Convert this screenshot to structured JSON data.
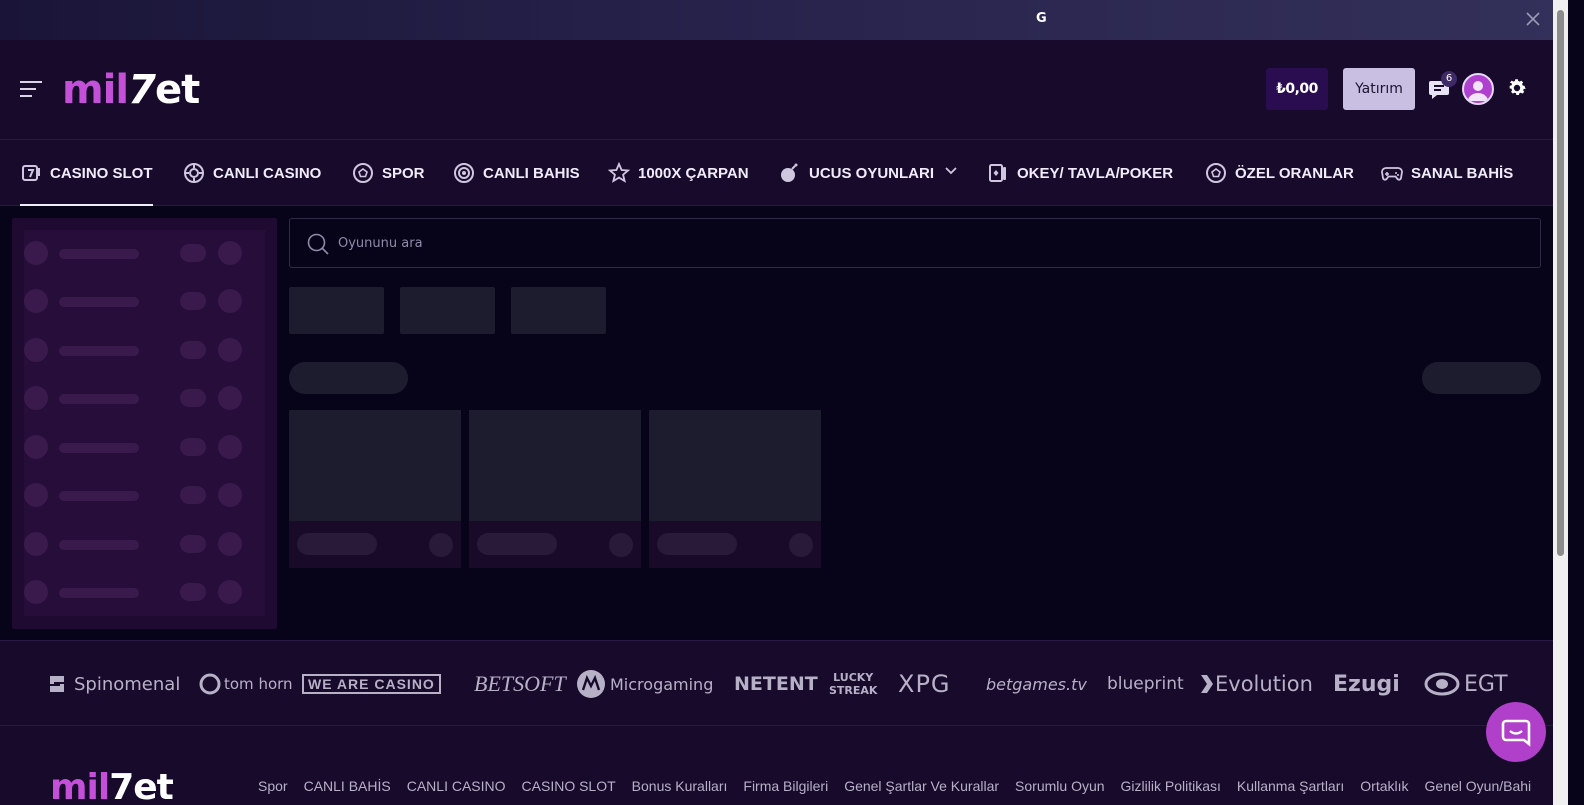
{
  "banner": {
    "text": "G",
    "close_label": "×"
  },
  "header": {
    "logo_parts": {
      "mil": "mil",
      "seven": "7",
      "et": "et"
    },
    "balance": "₺0,00",
    "deposit_label": "Yatırım",
    "messages_badge": "6"
  },
  "nav": {
    "items": [
      {
        "label": "CASINO SLOT",
        "icon": "casino-slot-icon",
        "active": true
      },
      {
        "label": "CANLI CASINO",
        "icon": "casino-chip-icon"
      },
      {
        "label": "SPOR",
        "icon": "soccer-ball-icon"
      },
      {
        "label": "CANLI BAHIS",
        "icon": "live-broadcast-icon"
      },
      {
        "label": "1000X ÇARPAN",
        "icon": "star-icon"
      },
      {
        "label": "UCUS OYUNLARI",
        "icon": "bomb-icon",
        "dropdown": true
      },
      {
        "label": "OKEY/ TAVLA/POKER",
        "icon": "playing-cards-icon"
      },
      {
        "label": "ÖZEL ORANLAR",
        "icon": "soccer-ball-icon"
      },
      {
        "label": "SANAL BAHİS",
        "icon": "gamepad-icon"
      }
    ]
  },
  "search": {
    "placeholder": "Oyununu ara"
  },
  "providers": [
    "Spinomenal",
    "tom horn",
    "WE ARE CASINO",
    "BETSOFT",
    "Microgaming",
    "NETENT",
    "LUCKY STREAK",
    "XPG",
    "betgames.tv",
    "blueprint",
    "Evolution",
    "Ezugi",
    "EGT"
  ],
  "footer": {
    "logo_parts": {
      "mil": "mil",
      "rest": "7et"
    },
    "links": [
      "Spor",
      "CANLI BAHİS",
      "CANLI CASINO",
      "CASINO SLOT",
      "Bonus Kuralları",
      "Firma Bilgileri",
      "Genel Şartlar Ve Kurallar",
      "Sorumlu Oyun",
      "Gizlilik Politikası",
      "Kullanma Şartları",
      "Ortaklık",
      "Genel Oyun/Bahi"
    ]
  },
  "colors": {
    "brand": "#c44fd8",
    "header_bg": "#170a2b",
    "page_bg": "#07041a",
    "deposit_bg": "#c9bfe3"
  }
}
